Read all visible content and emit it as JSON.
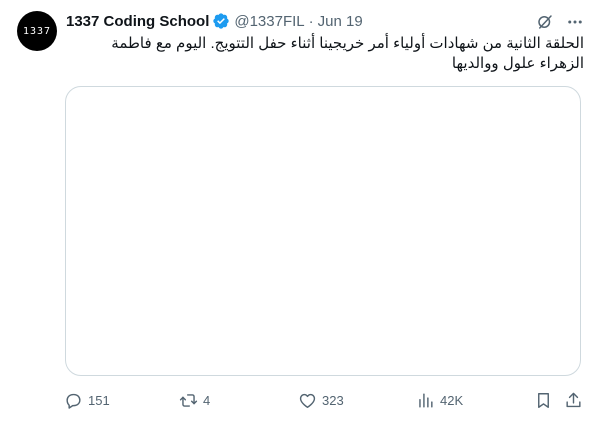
{
  "author": {
    "display_name": "1337 Coding School",
    "handle": "@1337FIL",
    "separator": "·",
    "date": "Jun 19",
    "avatar_text": "1337",
    "verified": true
  },
  "tweet": {
    "text": "الحلقة الثانية من شهادات أولياء أمر خريجينا أثناء حفل التتويج. اليوم مع فاطمة الزهراء علول ووالديها"
  },
  "stats": {
    "replies": "151",
    "reposts": "4",
    "likes": "323",
    "views": "42K"
  },
  "icons": {
    "top": [
      "grok-icon",
      "more-icon"
    ],
    "actions": [
      "reply-icon",
      "repost-icon",
      "like-icon",
      "views-icon",
      "bookmark-icon",
      "share-icon"
    ]
  },
  "colors": {
    "text": "#0f1419",
    "secondary": "#536471",
    "verified": "#1d9bf0",
    "border": "#cfd9de"
  }
}
